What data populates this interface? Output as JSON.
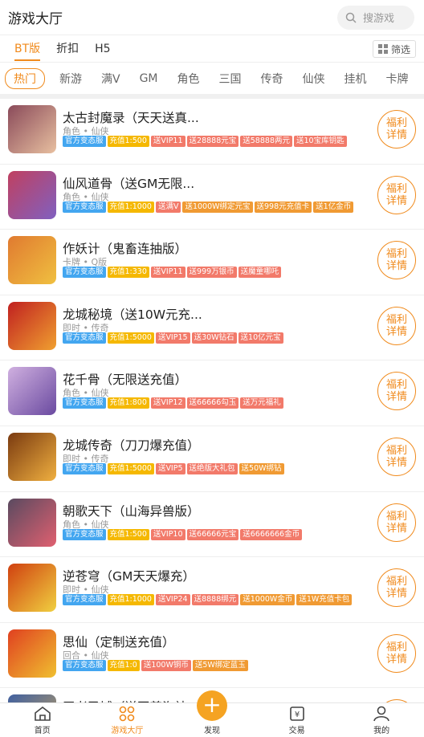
{
  "header": {
    "title": "游戏大厅",
    "search_placeholder": "搜游戏"
  },
  "type_tabs": [
    {
      "label": "BT版"
    },
    {
      "label": "折扣"
    },
    {
      "label": "H5"
    }
  ],
  "filter_label": "筛选",
  "categories": [
    "热门",
    "新游",
    "满V",
    "GM",
    "角色",
    "三国",
    "传奇",
    "仙侠",
    "挂机",
    "卡牌"
  ],
  "games": [
    {
      "name": "太古封魔录（天天送真...",
      "sub": "角色 • 仙侠",
      "tags": [
        [
          "官方变态服",
          "blue"
        ],
        [
          "充值1:500",
          "yellow"
        ],
        [
          "送VIP11",
          "red"
        ],
        [
          "送28888元宝",
          "red"
        ],
        [
          "送58888两元",
          "red"
        ],
        [
          "送10宝库钥匙",
          "red"
        ]
      ],
      "colors": [
        "#8a4a5a",
        "#e8c0a0"
      ]
    },
    {
      "name": "仙风道骨（送GM无限...",
      "sub": "角色 • 仙侠",
      "tags": [
        [
          "官方变态服",
          "blue"
        ],
        [
          "充值1:1000",
          "yellow"
        ],
        [
          "送满V",
          "red"
        ],
        [
          "送1000W绑定元宝",
          "orange"
        ],
        [
          "送998元充值卡",
          "orange"
        ],
        [
          "送1亿金币",
          "orange"
        ]
      ],
      "colors": [
        "#c04060",
        "#8060c0"
      ]
    },
    {
      "name": "作妖计（鬼畜连抽版）",
      "sub": "卡牌 • Q版",
      "tags": [
        [
          "官方变态服",
          "blue"
        ],
        [
          "充值1:330",
          "yellow"
        ],
        [
          "送VIP11",
          "red"
        ],
        [
          "送999万银币",
          "red"
        ],
        [
          "送魔童哪吒",
          "red"
        ]
      ],
      "colors": [
        "#e07a30",
        "#f0c040"
      ]
    },
    {
      "name": "龙城秘境（送10W元充...",
      "sub": "即时 • 传奇",
      "tags": [
        [
          "官方变态服",
          "blue"
        ],
        [
          "充值1:5000",
          "yellow"
        ],
        [
          "送VIP15",
          "red"
        ],
        [
          "送30W钻石",
          "red"
        ],
        [
          "送10亿元宝",
          "red"
        ]
      ],
      "colors": [
        "#c02020",
        "#f0a030"
      ]
    },
    {
      "name": "花千骨（无限送充值）",
      "sub": "角色 • 仙侠",
      "tags": [
        [
          "官方变态服",
          "blue"
        ],
        [
          "充值1:800",
          "yellow"
        ],
        [
          "送VIP12",
          "red"
        ],
        [
          "送66666勾玉",
          "red"
        ],
        [
          "送万元福礼",
          "red"
        ]
      ],
      "colors": [
        "#d0b0e0",
        "#6a4aa0"
      ]
    },
    {
      "name": "龙城传奇（刀刀爆充值）",
      "sub": "即时 • 传奇",
      "tags": [
        [
          "官方变态服",
          "blue"
        ],
        [
          "充值1:5000",
          "yellow"
        ],
        [
          "送VIP5",
          "red"
        ],
        [
          "送绝版大礼包",
          "red"
        ],
        [
          "送50W绑钻",
          "orange"
        ]
      ],
      "colors": [
        "#7a3a10",
        "#f0b040"
      ]
    },
    {
      "name": "朝歌天下（山海异兽版）",
      "sub": "角色 • 仙侠",
      "tags": [
        [
          "官方变态服",
          "blue"
        ],
        [
          "充值1:500",
          "yellow"
        ],
        [
          "送VIP10",
          "red"
        ],
        [
          "送66666元宝",
          "red"
        ],
        [
          "送6666666金币",
          "red"
        ]
      ],
      "colors": [
        "#5a4a60",
        "#e06070"
      ]
    },
    {
      "name": "逆苍穹（GM天天爆充）",
      "sub": "即时 • 仙侠",
      "tags": [
        [
          "官方变态服",
          "blue"
        ],
        [
          "充值1:1000",
          "yellow"
        ],
        [
          "送VIP24",
          "red"
        ],
        [
          "送8888绑元",
          "red"
        ],
        [
          "送1000W金币",
          "orange"
        ],
        [
          "送1W充值卡包",
          "orange"
        ]
      ],
      "colors": [
        "#d04010",
        "#f0d040"
      ]
    },
    {
      "name": "思仙（定制送充值）",
      "sub": "回合 • 仙侠",
      "tags": [
        [
          "官方变态服",
          "blue"
        ],
        [
          "充值1:0",
          "yellow"
        ],
        [
          "送100W铜币",
          "red"
        ],
        [
          "送5W绑定蓝玉",
          "orange"
        ]
      ],
      "colors": [
        "#e04020",
        "#f0c030"
      ]
    },
    {
      "name": "王者圣域（送至尊海神",
      "sub": "",
      "tags": [],
      "colors": [
        "#4060a0",
        "#c0a060"
      ]
    }
  ],
  "welfare_label": [
    "福利",
    "详情"
  ],
  "bottom_nav": [
    {
      "label": "首页"
    },
    {
      "label": "游戏大厅"
    },
    {
      "label": "发现"
    },
    {
      "label": "交易"
    },
    {
      "label": "我的"
    }
  ],
  "plus_glyph": "+"
}
